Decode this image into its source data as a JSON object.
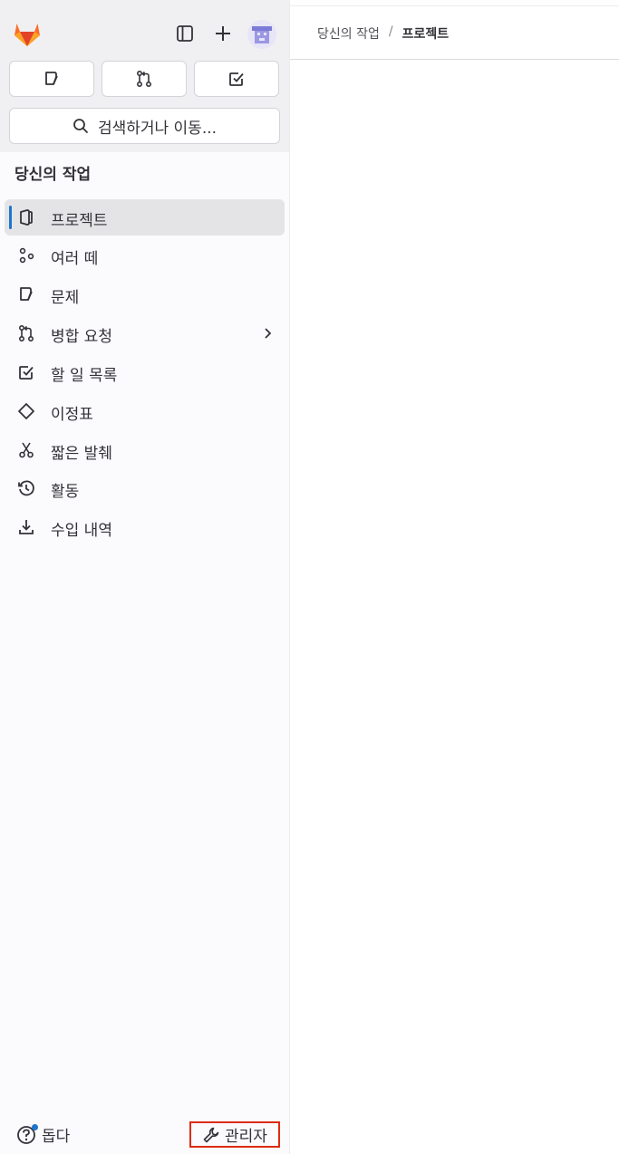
{
  "app": {
    "logo_icon": "gitlab-logo",
    "accent": "#1f75cb",
    "highlight": "#dd2b0e"
  },
  "top_actions": {
    "sidebar_toggle_icon": "sidebar-icon",
    "create_icon": "plus-icon",
    "avatar_icon": "user-avatar"
  },
  "quick_buttons": [
    {
      "icon": "issues-icon"
    },
    {
      "icon": "merge-request-icon"
    },
    {
      "icon": "todo-icon"
    }
  ],
  "search": {
    "label": "검색하거나 이동..."
  },
  "section_title": "당신의 작업",
  "nav": [
    {
      "label": "프로젝트",
      "icon": "project-icon",
      "active": true
    },
    {
      "label": "여러 떼",
      "icon": "group-icon"
    },
    {
      "label": "문제",
      "icon": "issues-icon"
    },
    {
      "label": "병합 요청",
      "icon": "merge-request-icon",
      "has_submenu": true
    },
    {
      "label": "할 일 목록",
      "icon": "todo-icon"
    },
    {
      "label": "이정표",
      "icon": "milestone-icon"
    },
    {
      "label": "짧은 발췌",
      "icon": "snippet-icon"
    },
    {
      "label": "활동",
      "icon": "history-icon"
    },
    {
      "label": "수입 내역",
      "icon": "import-icon"
    }
  ],
  "footer": {
    "help_label": "돕다",
    "admin_label": "관리자"
  },
  "breadcrumb": {
    "parent": "당신의 작업",
    "separator": "/",
    "current": "프로젝트"
  }
}
